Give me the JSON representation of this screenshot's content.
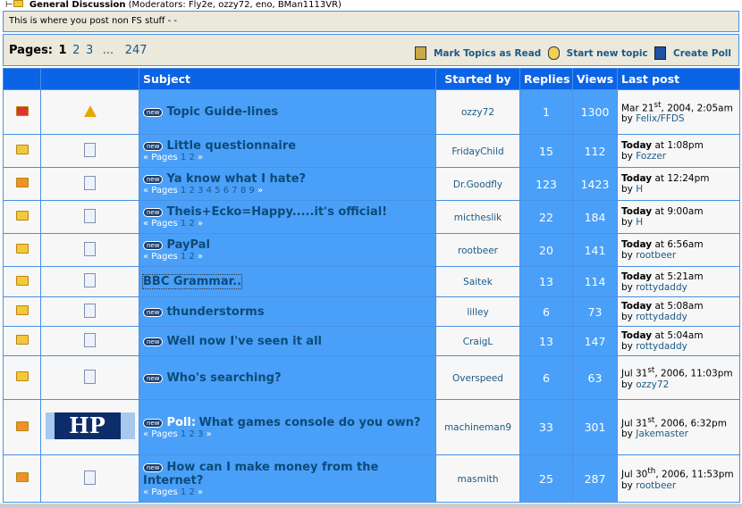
{
  "board": {
    "name": "General Discussion",
    "moderators": "(Moderators: Fly2e, ozzy72, eno, BMan1113VR)",
    "description": "This is where you post non FS stuff - -"
  },
  "pagination": {
    "label": "Pages:",
    "current": "1",
    "pages": [
      "2",
      "3"
    ],
    "ellipsis": "...",
    "last": "247"
  },
  "actions": {
    "mark_read": "Mark Topics as Read",
    "new_topic": "Start new topic",
    "create_poll": "Create Poll"
  },
  "columns": {
    "subject": "Subject",
    "started_by": "Started by",
    "replies": "Replies",
    "views": "Views",
    "last_post": "Last post"
  },
  "new_badge": "new",
  "pages_label": "Pages",
  "topics": [
    {
      "status": "locked",
      "icon": "warning",
      "title": "Topic Guide-lines",
      "pages": [],
      "starter": "ozzy72",
      "replies": "1",
      "views": "1300",
      "last_date": "Mar 21",
      "last_sup": "st",
      "last_rest": ", 2004, 2:05am",
      "last_by": "Felix/FFDS"
    },
    {
      "status": "normal",
      "icon": "doc",
      "title": "Little questionnaire",
      "pages": [
        "1",
        "2"
      ],
      "starter": "FridayChild",
      "replies": "15",
      "views": "112",
      "today": "Today",
      "last_time": "at 1:08pm",
      "last_by": "Fozzer"
    },
    {
      "status": "hot",
      "icon": "doc",
      "title": "Ya know what I hate?",
      "pages": [
        "1",
        "2",
        "3",
        "4",
        "5",
        "6",
        "7",
        "8",
        "9"
      ],
      "starter": "Dr.Goodfly",
      "replies": "123",
      "views": "1423",
      "today": "Today",
      "last_time": "at 12:24pm",
      "last_by": "H"
    },
    {
      "status": "normal",
      "icon": "doc",
      "title": "Theis+Ecko=Happy.....it's official!",
      "pages": [
        "1",
        "2"
      ],
      "starter": "mictheslik",
      "replies": "22",
      "views": "184",
      "today": "Today",
      "last_time": "at 9:00am",
      "last_by": "H"
    },
    {
      "status": "normal",
      "icon": "doc",
      "title": "PayPal",
      "pages": [
        "1",
        "2"
      ],
      "starter": "rootbeer",
      "replies": "20",
      "views": "141",
      "today": "Today",
      "last_time": "at 6:56am",
      "last_by": "rootbeer"
    },
    {
      "status": "plain",
      "icon": "doc",
      "title": "BBC Grammar..",
      "selected": true,
      "nonew": true,
      "pages": [],
      "starter": "Saitek",
      "replies": "13",
      "views": "114",
      "today": "Today",
      "last_time": "at 5:21am",
      "last_by": "rottydaddy"
    },
    {
      "status": "plain",
      "icon": "doc",
      "title": "thunderstorms",
      "pages": [],
      "starter": "lilley",
      "replies": "6",
      "views": "73",
      "today": "Today",
      "last_time": "at 5:08am",
      "last_by": "rottydaddy"
    },
    {
      "status": "plain",
      "icon": "doc",
      "title": "Well now I've seen it all",
      "pages": [],
      "starter": "CraigL",
      "replies": "13",
      "views": "147",
      "today": "Today",
      "last_time": "at 5:04am",
      "last_by": "rottydaddy"
    },
    {
      "status": "plain",
      "icon": "doc",
      "title": "Who's searching?",
      "pages": [],
      "starter": "Overspeed",
      "replies": "6",
      "views": "63",
      "last_date": "Jul 31",
      "last_sup": "st",
      "last_rest": ", 2006, 11:03pm",
      "last_by": "ozzy72"
    },
    {
      "status": "hot",
      "icon": "hp",
      "icon_text": "HP",
      "poll": "Poll:",
      "title": "What games console do you own?",
      "pages": [
        "1",
        "2",
        "3"
      ],
      "starter": "machineman9",
      "replies": "33",
      "views": "301",
      "last_date": "Jul 31",
      "last_sup": "st",
      "last_rest": ", 2006, 6:32pm",
      "last_by": "Jakemaster"
    },
    {
      "status": "hot",
      "icon": "doc",
      "title": "How can I make money from the Internet?",
      "pages": [
        "1",
        "2"
      ],
      "starter": "masmith",
      "replies": "25",
      "views": "287",
      "last_date": "Jul 30",
      "last_sup": "th",
      "last_rest": ", 2006, 11:53pm",
      "last_by": "rootbeer"
    }
  ],
  "by_label": "by"
}
